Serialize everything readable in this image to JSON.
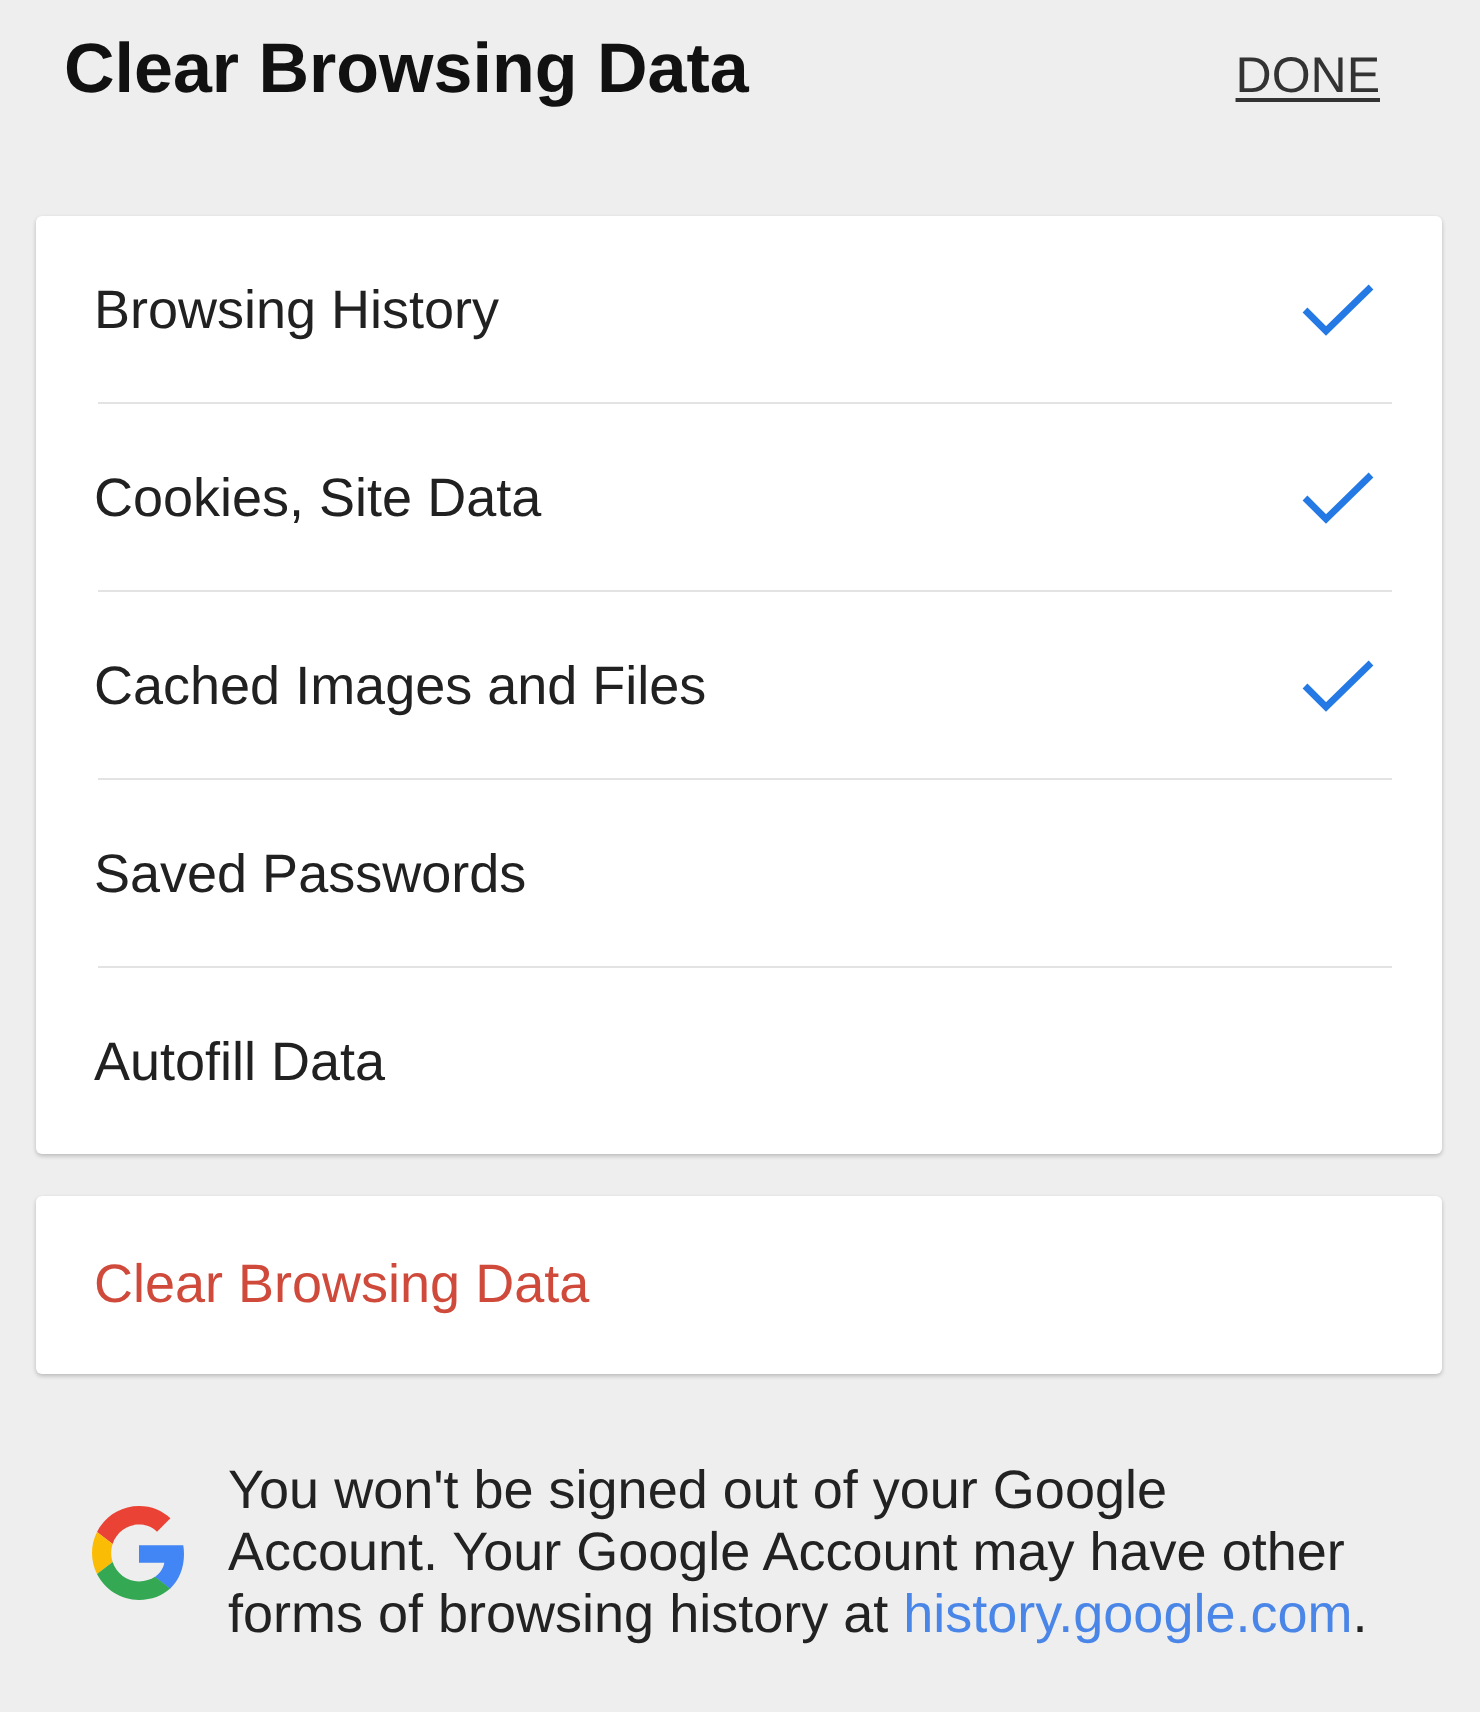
{
  "header": {
    "title": "Clear Browsing Data",
    "done_button": "DONE"
  },
  "options": [
    {
      "label": "Browsing History",
      "checked": true
    },
    {
      "label": "Cookies, Site Data",
      "checked": true
    },
    {
      "label": "Cached Images and Files",
      "checked": true
    },
    {
      "label": "Saved Passwords",
      "checked": false
    },
    {
      "label": "Autofill Data",
      "checked": false
    }
  ],
  "clear_button": {
    "label": "Clear Browsing Data"
  },
  "footer": {
    "text": "You won't be signed out of your Google Account. Your Google Account may have other forms of browsing history at",
    "link": "history.google.com",
    "suffix": "."
  }
}
